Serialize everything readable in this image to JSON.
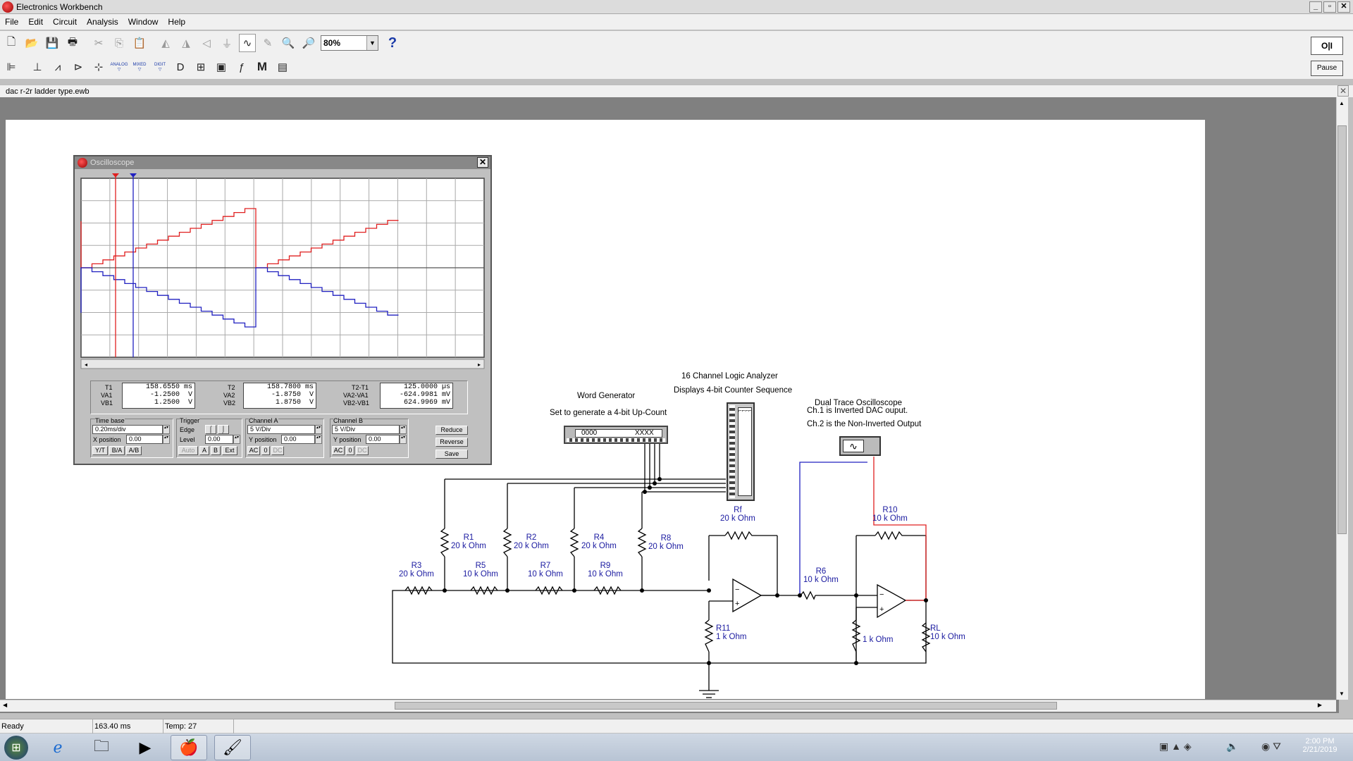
{
  "app": {
    "title": "Electronics Workbench",
    "window_buttons": [
      "_",
      "▫",
      "✕"
    ]
  },
  "menu": [
    "File",
    "Edit",
    "Circuit",
    "Analysis",
    "Window",
    "Help"
  ],
  "toolbar": {
    "zoom": "80%",
    "help": "?",
    "pause_label": "Pause",
    "power_label": "O|I"
  },
  "toolbar2_labels": {
    "analog": "ANALOG",
    "mixed": "MIXED",
    "digital": "DIGIT",
    "misc": "M"
  },
  "document": {
    "filename": "dac r-2r ladder type.ewb"
  },
  "oscilloscope": {
    "title": "Oscilloscope",
    "readouts": {
      "t1": {
        "label": "T1",
        "value": "158.6550",
        "unit": "ms"
      },
      "va1": {
        "label": "VA1",
        "value": "-1.2500",
        "unit": "V"
      },
      "vb1": {
        "label": "VB1",
        "value": "1.2500",
        "unit": "V"
      },
      "t2": {
        "label": "T2",
        "value": "158.7800",
        "unit": "ms"
      },
      "va2": {
        "label": "VA2",
        "value": "-1.8750",
        "unit": "V"
      },
      "vb2": {
        "label": "VB2",
        "value": "1.8750",
        "unit": "V"
      },
      "t2t1": {
        "label": "T2-T1",
        "value": "125.0000",
        "unit": "µs"
      },
      "va2va1": {
        "label": "VA2-VA1",
        "value": "-624.9981",
        "unit": "mV"
      },
      "vb2vb1": {
        "label": "VB2-VB1",
        "value": "624.9969",
        "unit": "mV"
      }
    },
    "timebase": {
      "title": "Time base",
      "value": "0.20ms/div",
      "xpos_label": "X position",
      "xpos": "0.00",
      "modes": [
        "Y/T",
        "B/A",
        "A/B"
      ]
    },
    "trigger": {
      "title": "Trigger",
      "edge_label": "Edge",
      "level_label": "Level",
      "level": "0.00",
      "modes": [
        "Auto",
        "A",
        "B",
        "Ext"
      ]
    },
    "channel_a": {
      "title": "Channel A",
      "value": "5 V/Div",
      "ypos_label": "Y position",
      "ypos": "0.00",
      "coupling": [
        "AC",
        "0",
        "DC"
      ]
    },
    "channel_b": {
      "title": "Channel B",
      "value": "5 V/Div",
      "ypos_label": "Y position",
      "ypos": "0.00",
      "coupling": [
        "AC",
        "0",
        "DC"
      ]
    },
    "buttons": [
      "Reduce",
      "Reverse",
      "Save"
    ],
    "colors": {
      "channel_a": "#e02020",
      "channel_b": "#2020c0",
      "cursor1": "#e02020",
      "cursor2": "#2020c0"
    }
  },
  "circuit": {
    "word_generator": {
      "title": "Word Generator",
      "note": "Set to generate a 4-bit Up-Count",
      "display_left": "0000",
      "display_right": "XXXX"
    },
    "logic_analyzer": {
      "title": "16 Channel Logic Analyzer",
      "note": "Displays 4-bit Counter Sequence"
    },
    "scope": {
      "title": "Dual Trace Oscilloscope",
      "note1": "Ch.1 is Inverted DAC ouput.",
      "note2": "Ch.2 is the Non-Inverted Output"
    },
    "resistors": [
      {
        "name": "R1",
        "value": "20 k Ohm"
      },
      {
        "name": "R2",
        "value": "20 k Ohm"
      },
      {
        "name": "R4",
        "value": "20 k Ohm"
      },
      {
        "name": "R8",
        "value": "20 k Ohm"
      },
      {
        "name": "R3",
        "value": "20 k Ohm"
      },
      {
        "name": "R5",
        "value": "10 k Ohm"
      },
      {
        "name": "R7",
        "value": "10 k Ohm"
      },
      {
        "name": "R9",
        "value": "10 k Ohm"
      },
      {
        "name": "Rf",
        "value": "20 k Ohm"
      },
      {
        "name": "R6",
        "value": "10 k Ohm"
      },
      {
        "name": "R10",
        "value": "10 k Ohm"
      },
      {
        "name": "R11",
        "value": "1 k Ohm"
      },
      {
        "name": "",
        "value": "1 k Ohm"
      },
      {
        "name": "RL",
        "value": "10 k Ohm"
      }
    ]
  },
  "status": {
    "state": "Ready",
    "time": "163.40 ms",
    "temp": "Temp:  27"
  },
  "tray": {
    "time": "2:00 PM",
    "date": "2/21/2019"
  }
}
